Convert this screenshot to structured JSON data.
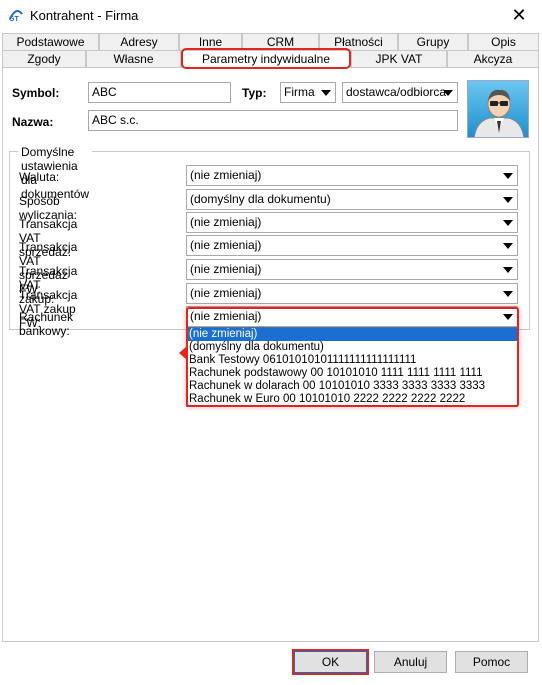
{
  "window": {
    "title": "Kontrahent - Firma",
    "close_glyph": "✕",
    "app_icon": "app-logo-icon"
  },
  "tabs": {
    "row1": [
      "Podstawowe",
      "Adresy",
      "Inne",
      "CRM",
      "Płatności",
      "Grupy",
      "Opis"
    ],
    "row2": [
      "Zgody",
      "Własne",
      "Parametry indywidualne",
      "JPK VAT",
      "Akcyza"
    ],
    "active": "Parametry indywidualne"
  },
  "form": {
    "symbol_label": "Symbol:",
    "symbol_value": "ABC",
    "typ_label": "Typ:",
    "typ_value": "Firma",
    "role_value": "dostawca/odbiorca",
    "nazwa_label": "Nazwa:",
    "nazwa_value": "ABC s.c."
  },
  "group": {
    "title": "Domyślne ustawienia dla dokumentów",
    "rows": [
      {
        "label": "Waluta:",
        "value": "(nie zmieniaj)"
      },
      {
        "label": "Sposób wyliczania:",
        "value": "(domyślny dla dokumentu)"
      },
      {
        "label": "Transakcja VAT sprzedaż:",
        "value": "(nie zmieniaj)"
      },
      {
        "label": "Transakcja VAT sprzedaż FW:",
        "value": "(nie zmieniaj)"
      },
      {
        "label": "Transakcja VAT zakup:",
        "value": "(nie zmieniaj)"
      },
      {
        "label": "Transakcja VAT zakup FW:",
        "value": "(nie zmieniaj)"
      },
      {
        "label": "Rachunek bankowy:",
        "value": "(nie zmieniaj)"
      }
    ]
  },
  "dropdown": {
    "options": [
      "(nie zmieniaj)",
      "(domyślny dla dokumentu)",
      "Bank Testowy 06101010101111111111111111",
      "Rachunek podstawowy 00 10101010 1111 1111 1111 1111",
      "Rachunek w dolarach 00 10101010 3333 3333 3333 3333",
      "Rachunek w Euro 00 10101010 2222 2222 2222 2222"
    ],
    "selected_index": 0
  },
  "buttons": {
    "ok": "OK",
    "cancel": "Anuluj",
    "help": "Pomoc"
  },
  "colors": {
    "highlight": "#e3261d",
    "selection": "#1b6fd0",
    "avatar_bg": "#2a9ad8"
  }
}
